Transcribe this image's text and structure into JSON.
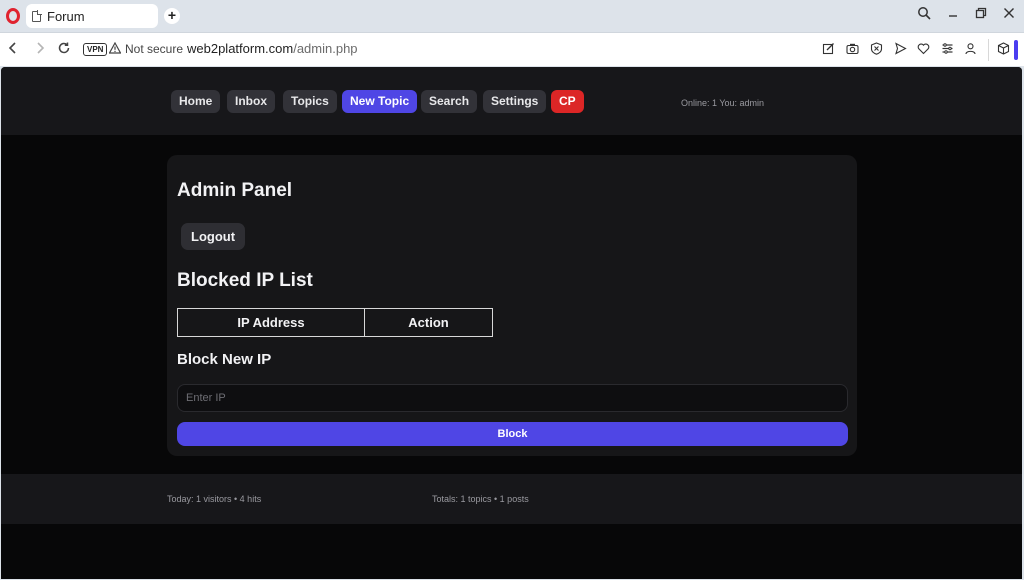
{
  "browser": {
    "tab_title": "Forum",
    "new_tab": "+",
    "security_label": "Not secure",
    "vpn_badge": "VPN",
    "url_host": "web2platform.com",
    "url_path": "/admin.php",
    "icons": [
      "back-icon",
      "forward-icon",
      "reload-icon",
      "warning-icon",
      "edit-icon",
      "camera-icon",
      "shield-icon",
      "send-icon",
      "heart-icon",
      "menu-icon",
      "profile-icon",
      "cube-icon",
      "search-icon",
      "minimize-icon",
      "restore-icon",
      "close-icon"
    ],
    "accent_color": "#4b3df0"
  },
  "nav": {
    "home": "Home",
    "inbox": "Inbox",
    "topics": "Topics",
    "new_topic": "New Topic",
    "search": "Search",
    "settings": "Settings",
    "cp": "CP",
    "active": "New Topic",
    "online_text": "Online: 1 You: admin"
  },
  "admin": {
    "title": "Admin Panel",
    "logout_label": "Logout",
    "blocked_title": "Blocked IP List",
    "table_headers": [
      "IP Address",
      "Action"
    ],
    "block_new_title": "Block New IP",
    "ip_placeholder": "Enter IP",
    "ip_value": "",
    "block_button": "Block"
  },
  "footer": {
    "today": "Today: 1 visitors • 4 hits",
    "totals": "Totals: 1 topics • 1 posts"
  },
  "colors": {
    "accent": "#4f46e5",
    "danger": "#dc2626",
    "background": "#070708",
    "panel": "#161618"
  }
}
